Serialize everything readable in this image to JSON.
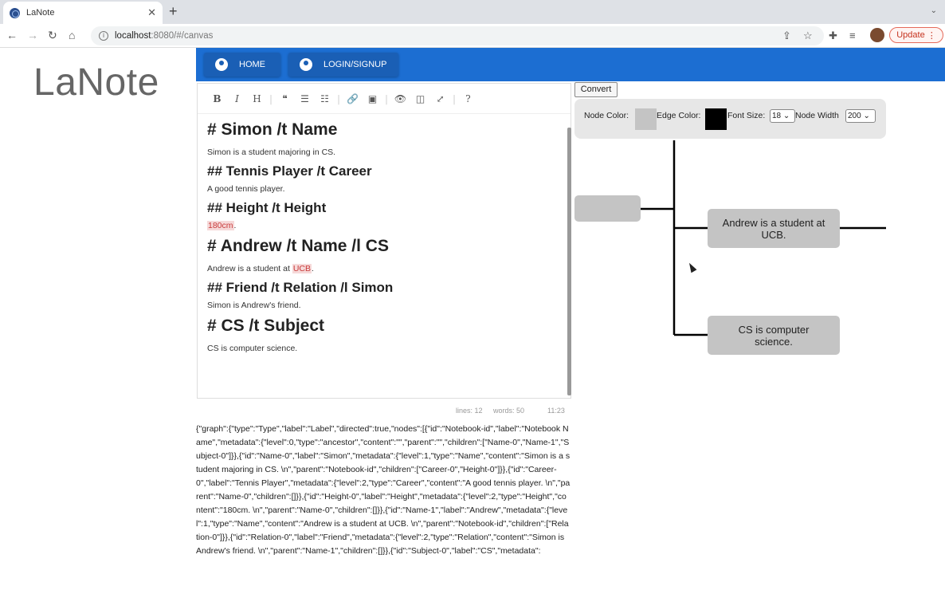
{
  "browser": {
    "tab_title": "LaNote",
    "url_host": "localhost",
    "url_path": ":8080/#/canvas",
    "update_label": "Update"
  },
  "page": {
    "logo": "LaNote",
    "appbar": {
      "home_label": "HOME",
      "login_label": "LOGIN/SIGNUP",
      "color": "#1c6ed2"
    }
  },
  "editor": {
    "toolbar_icons": [
      "bold-icon",
      "italic-icon",
      "heading-icon",
      "quote-icon",
      "unordered-list-icon",
      "ordered-list-icon",
      "link-icon",
      "image-icon",
      "preview-icon",
      "side-by-side-icon",
      "fullscreen-icon",
      "help-icon"
    ],
    "toolbar_glyphs": [
      "B",
      "I",
      "H",
      "❝",
      "☰",
      "☷",
      "🔗",
      "▣",
      "👁",
      "◫",
      "⤢",
      "?"
    ],
    "lines": [
      {
        "type": "h1",
        "text": "# Simon /t Name"
      },
      {
        "type": "p",
        "text": "Simon is a student majoring in CS."
      },
      {
        "type": "h2",
        "text": "## Tennis Player /t Career"
      },
      {
        "type": "p",
        "text": "A good tennis player."
      },
      {
        "type": "h2",
        "text": "## Height /t Height"
      },
      {
        "type": "p",
        "text": "",
        "highlight": "180cm",
        "suffix": "."
      },
      {
        "type": "h1",
        "text": "# Andrew /t Name /l CS"
      },
      {
        "type": "p",
        "text": "Andrew is a student at ",
        "highlight": "UCB",
        "suffix": "."
      },
      {
        "type": "h2",
        "text": "## Friend /t Relation /l Simon"
      },
      {
        "type": "p",
        "text": "Simon is Andrew's friend."
      },
      {
        "type": "h1",
        "text": "# CS /t Subject"
      },
      {
        "type": "p",
        "text": "CS is computer science."
      }
    ],
    "status": {
      "lines": "lines: 12",
      "words": "words: 50",
      "cursor": "11:23"
    }
  },
  "json_output": "{\"graph\":{\"type\":\"Type\",\"label\":\"Label\",\"directed\":true,\"nodes\":[{\"id\":\"Notebook-id\",\"label\":\"Notebook Name\",\"metadata\":{\"level\":0,\"type\":\"ancestor\",\"content\":\"\",\"parent\":\"\",\"children\":[\"Name-0\",\"Name-1\",\"Subject-0\"]}},{\"id\":\"Name-0\",\"label\":\"Simon\",\"metadata\":{\"level\":1,\"type\":\"Name\",\"content\":\"Simon is a student majoring in CS. \\n\",\"parent\":\"Notebook-id\",\"children\":[\"Career-0\",\"Height-0\"]}},{\"id\":\"Career-0\",\"label\":\"Tennis Player\",\"metadata\":{\"level\":2,\"type\":\"Career\",\"content\":\"A good tennis player. \\n\",\"parent\":\"Name-0\",\"children\":[]}},{\"id\":\"Height-0\",\"label\":\"Height\",\"metadata\":{\"level\":2,\"type\":\"Height\",\"content\":\"180cm. \\n\",\"parent\":\"Name-0\",\"children\":[]}},{\"id\":\"Name-1\",\"label\":\"Andrew\",\"metadata\":{\"level\":1,\"type\":\"Name\",\"content\":\"Andrew is a student at UCB. \\n\",\"parent\":\"Notebook-id\",\"children\":[\"Relation-0\"]}},{\"id\":\"Relation-0\",\"label\":\"Friend\",\"metadata\":{\"level\":2,\"type\":\"Relation\",\"content\":\"Simon is Andrew's friend. \\n\",\"parent\":\"Name-1\",\"children\":[]}},{\"id\":\"Subject-0\",\"label\":\"CS\",\"metadata\":",
  "canvas": {
    "convert_label": "Convert",
    "node_color_label": "Node Color:",
    "node_color": "#c4c4c4",
    "edge_color_label": "Edge Color:",
    "edge_color": "#000000",
    "font_size_label": "Font Size:",
    "font_size_value": "18",
    "node_width_label": "Node Width",
    "node_width_value": "200",
    "nodes": {
      "andrew": "Andrew is a student at UCB.",
      "cs": "CS is computer science."
    }
  }
}
